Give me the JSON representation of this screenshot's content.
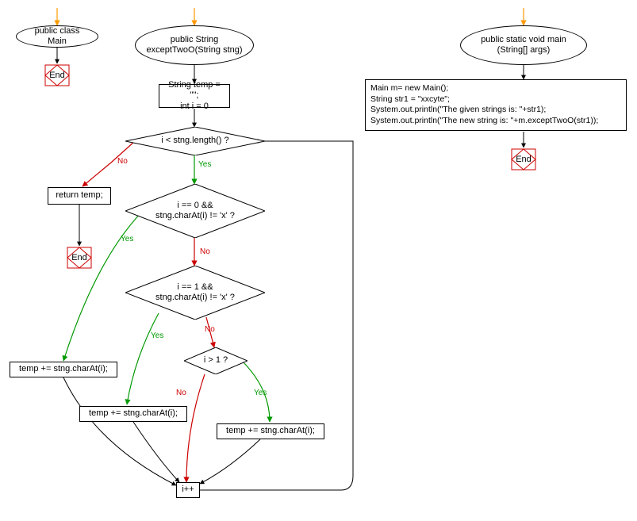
{
  "nodes": {
    "classMain": "public class Main",
    "methodExcept": "public String\nexceptTwoO(String stng)",
    "init": "String temp = \"\";\nint i = 0",
    "condLen": "i < stng.length() ?",
    "returnTemp": "return temp;",
    "cond0": "i == 0 &&\nstng.charAt(i) != 'x' ?",
    "cond1": "i == 1 &&\nstng.charAt(i) != 'x' ?",
    "condGt1": "i > 1 ?",
    "temp1": "temp += stng.charAt(i);",
    "temp2": "temp += stng.charAt(i);",
    "temp3": "temp += stng.charAt(i);",
    "inc": "i++",
    "mainMethod": "public static void main\n(String[] args)",
    "end": "End"
  },
  "labels": {
    "yes": "Yes",
    "no": "No"
  },
  "mainCode": "Main m= new Main();\nString str1 = \"xxcyte\";\nSystem.out.println(\"The given strings is: \"+str1);\nSystem.out.println(\"The new string is: \"+m.exceptTwoO(str1));"
}
